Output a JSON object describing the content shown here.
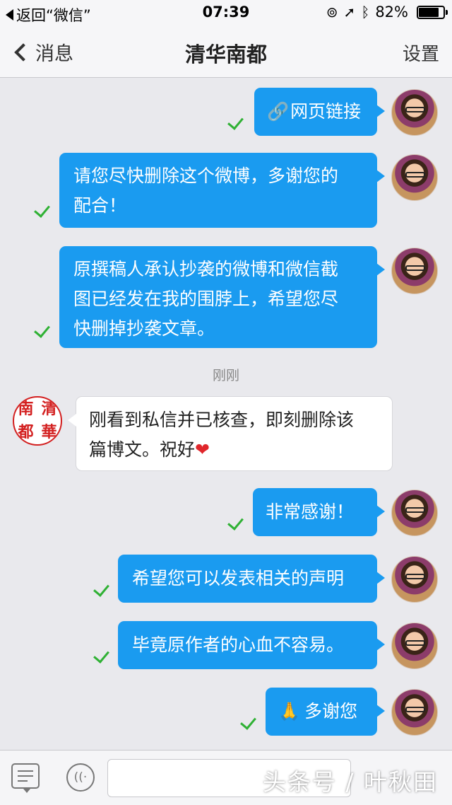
{
  "status_bar": {
    "back_app": "返回“微信”",
    "time": "07:39",
    "battery_percent": "82%",
    "battery_level": 0.82
  },
  "nav": {
    "back_label": "消息",
    "title": "清华南都",
    "settings_label": "设置"
  },
  "messages": [
    {
      "id": 1,
      "direction": "outgoing",
      "link_icon": "🔗",
      "text": "网页链接"
    },
    {
      "id": 2,
      "direction": "outgoing",
      "lines": [
        "请您尽快删除这个微博，多谢您的",
        "配合！"
      ]
    },
    {
      "id": 3,
      "direction": "outgoing",
      "lines": [
        "原撰稿人承认抄袭的微博和微信截",
        "图已经发在我的围脖上，希望您尽",
        "快删掉抄袭文章。"
      ]
    },
    {
      "id": 4,
      "direction": "incoming",
      "lines": [
        "刚看到私信并已核查，即刻删除该",
        "篇博文。祝好"
      ],
      "emoji": "❤"
    },
    {
      "id": 5,
      "direction": "outgoing",
      "text": "非常感谢！"
    },
    {
      "id": 6,
      "direction": "outgoing",
      "text": "希望您可以发表相关的声明"
    },
    {
      "id": 7,
      "direction": "outgoing",
      "text": "毕竟原作者的心血不容易。"
    },
    {
      "id": 8,
      "direction": "outgoing",
      "emoji": "🙏",
      "text": "多谢您"
    }
  ],
  "timestamp": "刚刚",
  "sender_seal": [
    "南",
    "清",
    "都",
    "華"
  ],
  "input_bar": {
    "placeholder": "",
    "watermark": "头条号 / 叶秋田"
  },
  "colors": {
    "outgoing_bubble": "#1a9bf0",
    "incoming_bubble": "#ffffff",
    "read_check": "#2fb134",
    "background": "#e9e9ed"
  }
}
